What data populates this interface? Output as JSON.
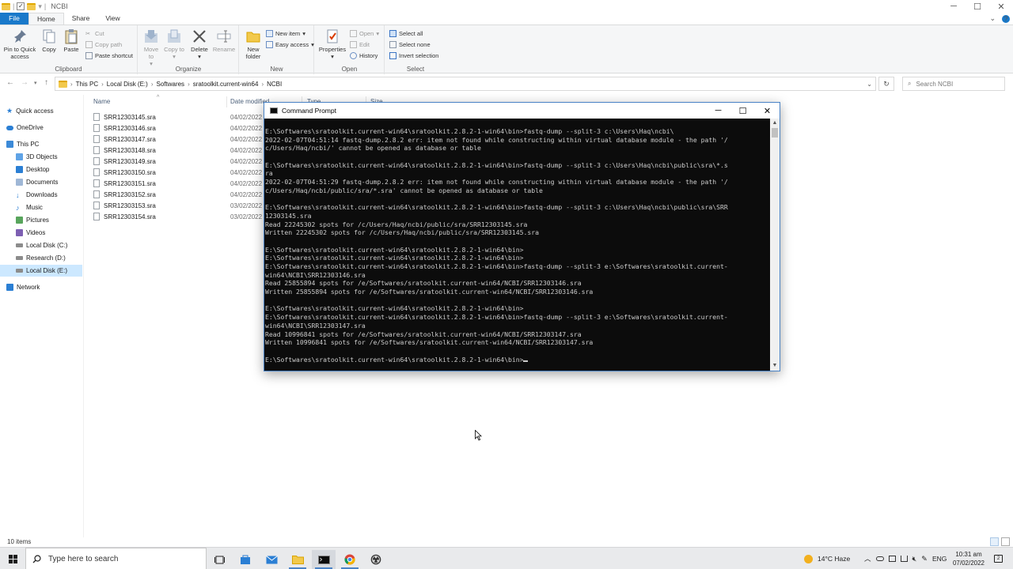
{
  "window": {
    "title": "NCBI",
    "controls": [
      "─",
      "☐",
      "✕"
    ]
  },
  "ribbon_tabs": [
    "File",
    "Home",
    "Share",
    "View"
  ],
  "ribbon": {
    "clipboard": {
      "label": "Clipboard",
      "pin": "Pin to Quick access",
      "copy": "Copy",
      "paste": "Paste",
      "cut": "Cut",
      "copy_path": "Copy path",
      "paste_shortcut": "Paste shortcut"
    },
    "organize": {
      "label": "Organize",
      "move_to": "Move to",
      "copy_to": "Copy to",
      "delete": "Delete",
      "rename": "Rename"
    },
    "new": {
      "label": "New",
      "new_folder": "New folder",
      "new_item": "New item",
      "easy_access": "Easy access"
    },
    "open": {
      "label": "Open",
      "properties": "Properties",
      "open": "Open",
      "edit": "Edit",
      "history": "History"
    },
    "select": {
      "label": "Select",
      "select_all": "Select all",
      "select_none": "Select none",
      "invert": "Invert selection"
    }
  },
  "address": {
    "crumbs": [
      "This PC",
      "Local Disk (E:)",
      "Softwares",
      "sratoolkit.current-win64",
      "NCBI"
    ],
    "search_placeholder": "Search NCBI"
  },
  "nav": {
    "quick_access": "Quick access",
    "onedrive": "OneDrive",
    "this_pc": "This PC",
    "items": [
      "3D Objects",
      "Desktop",
      "Documents",
      "Downloads",
      "Music",
      "Pictures",
      "Videos",
      "Local Disk (C:)",
      "Research (D:)",
      "Local Disk (E:)"
    ],
    "network": "Network"
  },
  "filelist": {
    "col_name": "Name",
    "col_date": "Date modified",
    "col_type": "Type",
    "col_size": "Size",
    "files": [
      {
        "name": "SRR12303145.sra",
        "date": "04/02/2022"
      },
      {
        "name": "SRR12303146.sra",
        "date": "04/02/2022"
      },
      {
        "name": "SRR12303147.sra",
        "date": "04/02/2022"
      },
      {
        "name": "SRR12303148.sra",
        "date": "04/02/2022"
      },
      {
        "name": "SRR12303149.sra",
        "date": "04/02/2022"
      },
      {
        "name": "SRR12303150.sra",
        "date": "04/02/2022"
      },
      {
        "name": "SRR12303151.sra",
        "date": "04/02/2022"
      },
      {
        "name": "SRR12303152.sra",
        "date": "04/02/2022"
      },
      {
        "name": "SRR12303153.sra",
        "date": "03/02/2022"
      },
      {
        "name": "SRR12303154.sra",
        "date": "03/02/2022"
      }
    ]
  },
  "status": {
    "count": "10 items"
  },
  "cmd": {
    "title": "Command Prompt",
    "lines": [
      "E:\\Softwares\\sratoolkit.current-win64\\sratoolkit.2.8.2-1-win64\\bin>fastq-dump --split-3 c:\\Users\\Haq\\ncbi\\",
      "2022-02-07T04:51:14 fastq-dump.2.8.2 err: item not found while constructing within virtual database module - the path '/",
      "c/Users/Haq/ncbi/' cannot be opened as database or table",
      "",
      "E:\\Softwares\\sratoolkit.current-win64\\sratoolkit.2.8.2-1-win64\\bin>fastq-dump --split-3 c:\\Users\\Haq\\ncbi\\public\\sra\\*.s",
      "ra",
      "2022-02-07T04:51:29 fastq-dump.2.8.2 err: item not found while constructing within virtual database module - the path '/",
      "c/Users/Haq/ncbi/public/sra/*.sra' cannot be opened as database or table",
      "",
      "E:\\Softwares\\sratoolkit.current-win64\\sratoolkit.2.8.2-1-win64\\bin>fastq-dump --split-3 c:\\Users\\Haq\\ncbi\\public\\sra\\SRR",
      "12303145.sra",
      "Read 22245302 spots for /c/Users/Haq/ncbi/public/sra/SRR12303145.sra",
      "Written 22245302 spots for /c/Users/Haq/ncbi/public/sra/SRR12303145.sra",
      "",
      "E:\\Softwares\\sratoolkit.current-win64\\sratoolkit.2.8.2-1-win64\\bin>",
      "E:\\Softwares\\sratoolkit.current-win64\\sratoolkit.2.8.2-1-win64\\bin>",
      "E:\\Softwares\\sratoolkit.current-win64\\sratoolkit.2.8.2-1-win64\\bin>fastq-dump --split-3 e:\\Softwares\\sratoolkit.current-",
      "win64\\NCBI\\SRR12303146.sra",
      "Read 25855894 spots for /e/Softwares/sratoolkit.current-win64/NCBI/SRR12303146.sra",
      "Written 25855894 spots for /e/Softwares/sratoolkit.current-win64/NCBI/SRR12303146.sra",
      "",
      "E:\\Softwares\\sratoolkit.current-win64\\sratoolkit.2.8.2-1-win64\\bin>",
      "E:\\Softwares\\sratoolkit.current-win64\\sratoolkit.2.8.2-1-win64\\bin>fastq-dump --split-3 e:\\Softwares\\sratoolkit.current-",
      "win64\\NCBI\\SRR12303147.sra",
      "Read 10996841 spots for /e/Softwares/sratoolkit.current-win64/NCBI/SRR12303147.sra",
      "Written 10996841 spots for /e/Softwares/sratoolkit.current-win64/NCBI/SRR12303147.sra",
      "",
      "E:\\Softwares\\sratoolkit.current-win64\\sratoolkit.2.8.2-1-win64\\bin>"
    ]
  },
  "taskbar": {
    "search_placeholder": "Type here to search",
    "weather": "14°C  Haze",
    "lang": "ENG",
    "time": "10:31 am",
    "date": "07/02/2022"
  },
  "colors": {
    "accent": "#1979ca",
    "selection": "#cce8ff",
    "console_bg": "#0c0c0c",
    "console_text": "#cccccc"
  }
}
